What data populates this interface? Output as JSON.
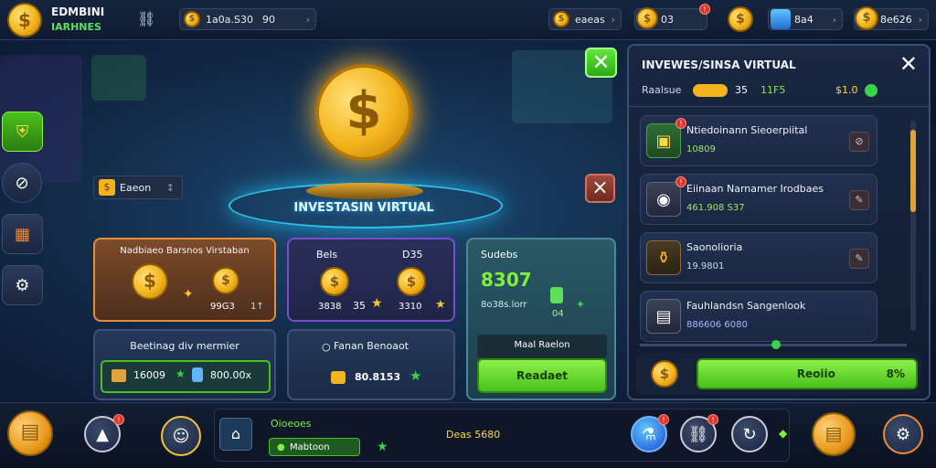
{
  "header": {
    "title_line1": "EDMBINI",
    "title_line2": "IARHNES",
    "left_counter": "1a0a.S30",
    "left_counter_suffix": "90",
    "res1": "eaeas",
    "res2": "03",
    "res3": "8a4",
    "res4": "8e626"
  },
  "sidebar": {
    "icons": [
      "shield-icon",
      "crossed-icon",
      "map-icon",
      "gear-icon"
    ]
  },
  "main": {
    "filter_label": "Eaeon",
    "hero_title": "INVESTASIN VIRTUAL",
    "card1": {
      "title": "Nadbiaeo Barsnos Virstaban",
      "value": "99G3",
      "mult": "1↑"
    },
    "card2": {
      "label_left": "Bels",
      "label_right": "D35",
      "v1": "3838",
      "v1b": "35",
      "v2": "3310"
    },
    "card3": {
      "title": "Sudebs",
      "amount": "8307",
      "subtitle": "8o38s.lorr",
      "small": "04"
    },
    "box1": {
      "title": "Beetinag div mermier",
      "left_val": "16009",
      "right_val": "800.00x"
    },
    "box2": {
      "title": "Fanan Benoaot",
      "value": "80.8153"
    },
    "box3": {
      "title": "Maal Raelon",
      "button": "Readaet"
    }
  },
  "right_panel": {
    "title": "INVEWES/SINSA VIRTUAL",
    "sub_label": "Raalsue",
    "sub_val1": "35",
    "sub_val2": "11F5",
    "sub_val3": "$1.0",
    "items": [
      {
        "title": "Ntiedoinann  Sieoerpiital",
        "value": "10809"
      },
      {
        "title": "Eiinaan Narnamer Irodbaes",
        "value": "461.908  S37"
      },
      {
        "title": "Saonolioria",
        "value": "19.9801"
      },
      {
        "title": "Fauhlandsn Sangenlook",
        "value": "886606  6080"
      }
    ],
    "footer_button": "Reoiio",
    "footer_percent": "8%"
  },
  "bottom": {
    "label1": "Oioeoes",
    "label2": "Mabtoon",
    "center": "Deas 5680"
  },
  "colors": {
    "accent_green": "#49c11b",
    "gold": "#f3b31c",
    "orange_card": "#e98b3a",
    "purple_card": "#7c4bd0"
  }
}
